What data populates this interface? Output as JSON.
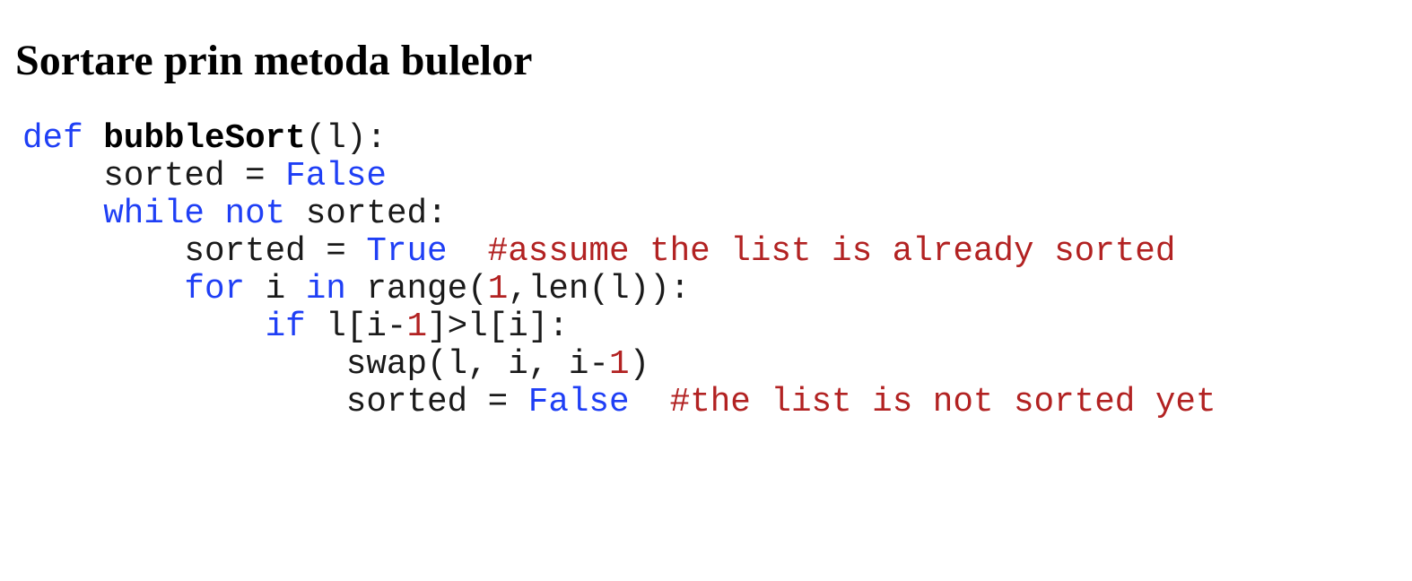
{
  "document": {
    "title": "Sortare prin metoda bulelor"
  },
  "code": {
    "language": "python",
    "colors": {
      "keyword": "#1f3ff5",
      "number": "#b22222",
      "comment": "#b22222",
      "plain": "#1a1a1a"
    },
    "lines": [
      [
        {
          "t": "kw",
          "s": "def"
        },
        {
          "t": "plain",
          "s": " "
        },
        {
          "t": "fn",
          "s": "bubbleSort"
        },
        {
          "t": "plain",
          "s": "(l):"
        }
      ],
      [
        {
          "t": "plain",
          "s": "    sorted = "
        },
        {
          "t": "kw",
          "s": "False"
        }
      ],
      [
        {
          "t": "plain",
          "s": "    "
        },
        {
          "t": "kw",
          "s": "while"
        },
        {
          "t": "plain",
          "s": " "
        },
        {
          "t": "kw",
          "s": "not"
        },
        {
          "t": "plain",
          "s": " sorted:"
        }
      ],
      [
        {
          "t": "plain",
          "s": "        sorted = "
        },
        {
          "t": "kw",
          "s": "True"
        },
        {
          "t": "plain",
          "s": "  "
        },
        {
          "t": "comment",
          "s": "#assume the list is already sorted"
        }
      ],
      [
        {
          "t": "plain",
          "s": "        "
        },
        {
          "t": "kw",
          "s": "for"
        },
        {
          "t": "plain",
          "s": " i "
        },
        {
          "t": "kw",
          "s": "in"
        },
        {
          "t": "plain",
          "s": " range("
        },
        {
          "t": "num",
          "s": "1"
        },
        {
          "t": "plain",
          "s": ",len(l)):"
        }
      ],
      [
        {
          "t": "plain",
          "s": "            "
        },
        {
          "t": "kw",
          "s": "if"
        },
        {
          "t": "plain",
          "s": " l[i-"
        },
        {
          "t": "num",
          "s": "1"
        },
        {
          "t": "plain",
          "s": "]>l[i]:"
        }
      ],
      [
        {
          "t": "plain",
          "s": "                swap(l, i, i-"
        },
        {
          "t": "num",
          "s": "1"
        },
        {
          "t": "plain",
          "s": ")"
        }
      ],
      [
        {
          "t": "plain",
          "s": "                sorted = "
        },
        {
          "t": "kw",
          "s": "False"
        },
        {
          "t": "plain",
          "s": "  "
        },
        {
          "t": "comment",
          "s": "#the list is not sorted yet"
        }
      ]
    ]
  }
}
